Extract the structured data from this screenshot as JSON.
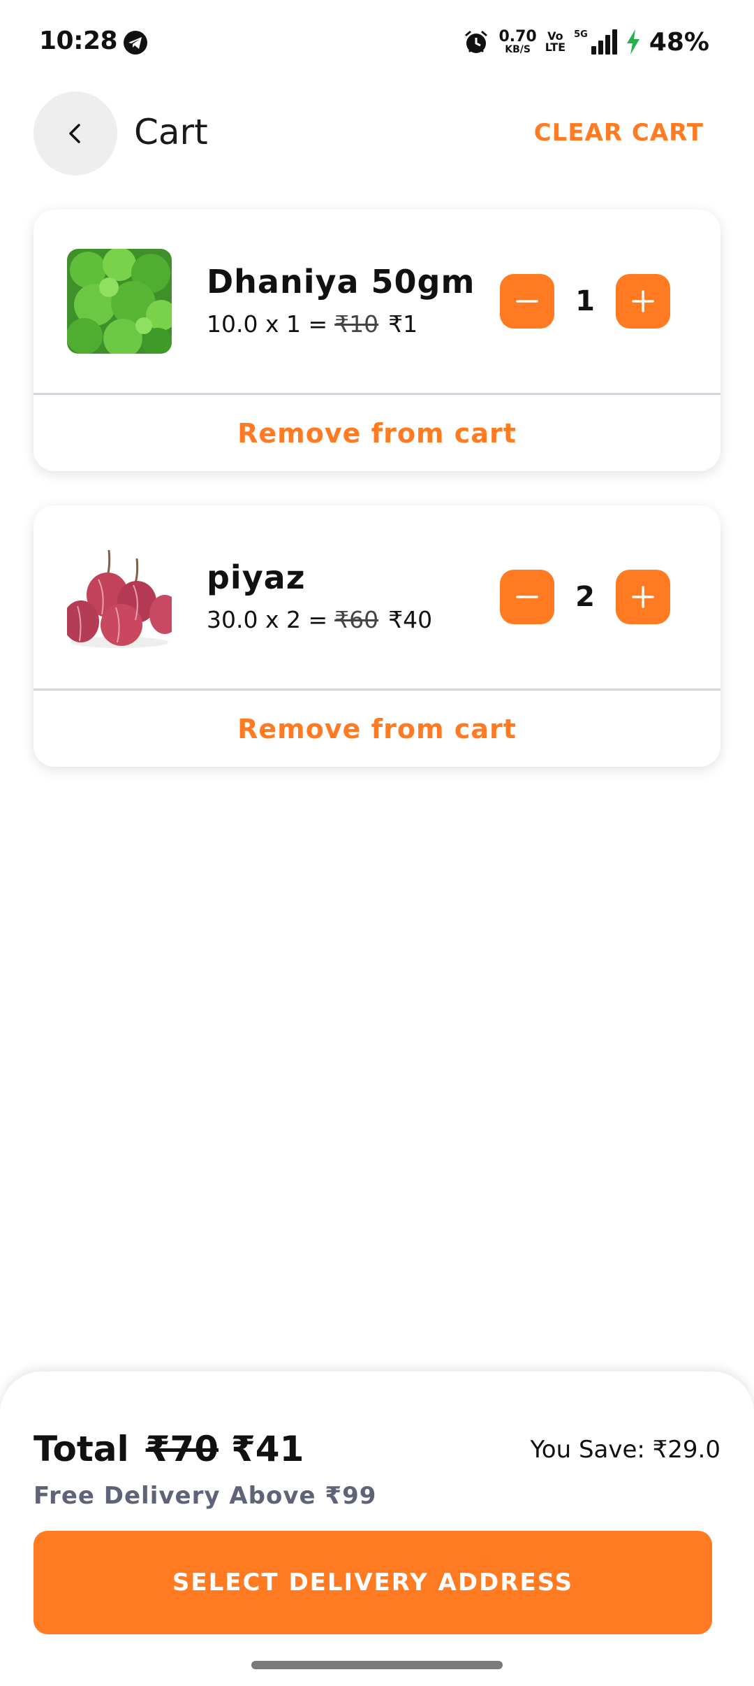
{
  "status_bar": {
    "time": "10:28",
    "net_speed_value": "0.70",
    "net_speed_unit": "KB/S",
    "volte_top": "Vo",
    "volte_bottom": "LTE",
    "network": "5G",
    "battery": "48%",
    "icons": [
      "telegram-icon",
      "alarm-icon",
      "signal-icon",
      "charging-bolt-icon"
    ]
  },
  "header": {
    "title": "Cart",
    "clear_label": "CLEAR CART"
  },
  "cart": {
    "items": [
      {
        "name": "Dhaniya 50gm",
        "unit_price": "10.0",
        "quantity": "1",
        "original_total": "₹10",
        "final_total": "₹1",
        "remove_label": "Remove from cart"
      },
      {
        "name": "piyaz",
        "unit_price": "30.0",
        "quantity": "2",
        "original_total": "₹60",
        "final_total": "₹40",
        "remove_label": "Remove from cart"
      }
    ]
  },
  "summary": {
    "total_label": "Total",
    "original_total": "₹70",
    "final_total": "₹41",
    "you_save": "You Save: ₹29.0",
    "free_delivery": "Free Delivery Above ₹99",
    "cta_label": "SELECT DELIVERY ADDRESS"
  },
  "colors": {
    "accent": "#ff7a21",
    "muted_text": "#5f6377",
    "back_button_bg": "#eeeeee",
    "charging": "#22b14c"
  }
}
